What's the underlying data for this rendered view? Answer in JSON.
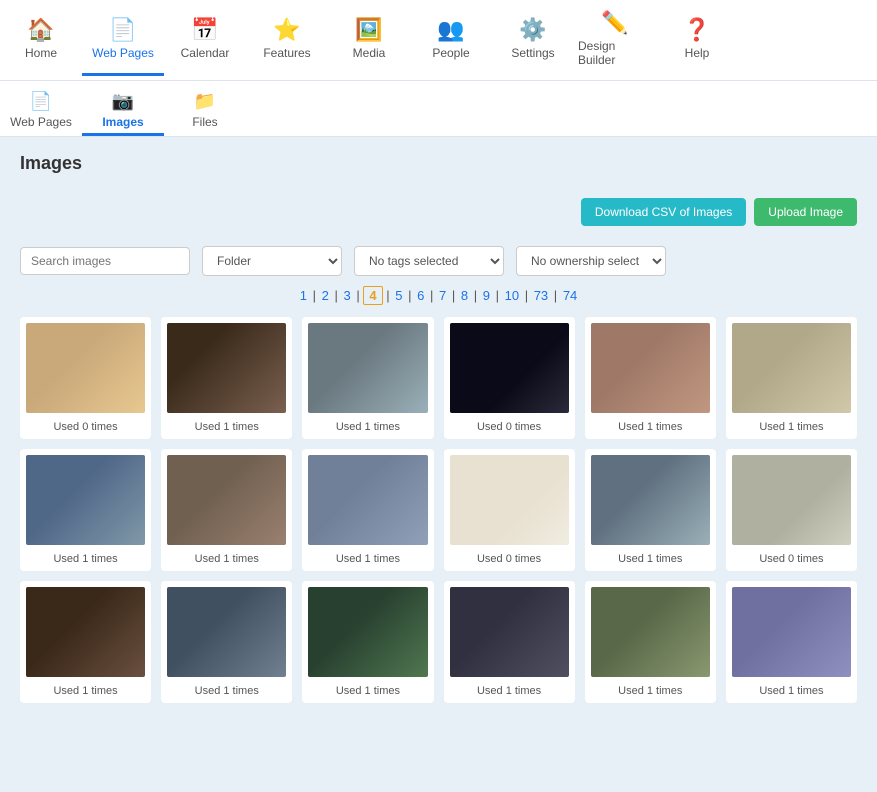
{
  "top_nav": {
    "items": [
      {
        "id": "home",
        "label": "Home",
        "icon": "🏠",
        "active": false
      },
      {
        "id": "web-pages",
        "label": "Web Pages",
        "icon": "📄",
        "active": false
      },
      {
        "id": "calendar",
        "label": "Calendar",
        "icon": "📅",
        "active": false
      },
      {
        "id": "features",
        "label": "Features",
        "icon": "⭐",
        "active": false
      },
      {
        "id": "media",
        "label": "Media",
        "icon": "🖼️",
        "active": false
      },
      {
        "id": "people",
        "label": "People",
        "icon": "👥",
        "active": false
      },
      {
        "id": "settings",
        "label": "Settings",
        "icon": "⚙️",
        "active": false
      },
      {
        "id": "design-builder",
        "label": "Design Builder",
        "icon": "✏️",
        "active": false
      },
      {
        "id": "help",
        "label": "Help",
        "icon": "❓",
        "active": false
      }
    ]
  },
  "sub_nav": {
    "items": [
      {
        "id": "web-pages",
        "label": "Web Pages",
        "icon": "📄",
        "active": false
      },
      {
        "id": "images",
        "label": "Images",
        "icon": "📷",
        "active": true
      },
      {
        "id": "files",
        "label": "Files",
        "icon": "📁",
        "active": false
      }
    ]
  },
  "page": {
    "title": "Images"
  },
  "toolbar": {
    "download_csv_label": "Download CSV of Images",
    "upload_label": "Upload Image"
  },
  "filters": {
    "search_placeholder": "Search images",
    "folder_placeholder": "Folder",
    "tags_placeholder": "No tags selected",
    "ownership_placeholder": "No ownership selected"
  },
  "pagination": {
    "pages": [
      "1",
      "2",
      "3",
      "4",
      "5",
      "6",
      "7",
      "8",
      "9",
      "10",
      "73",
      "74"
    ],
    "current": "4",
    "separator": "|"
  },
  "images": [
    {
      "id": 1,
      "used": "Used 0 times",
      "color": "#b08060"
    },
    {
      "id": 2,
      "used": "Used 1 times",
      "color": "#5a4a3a"
    },
    {
      "id": 3,
      "used": "Used 1 times",
      "color": "#6a7a8a"
    },
    {
      "id": 4,
      "used": "Used 0 times",
      "color": "#1a1a2a"
    },
    {
      "id": 5,
      "used": "Used 1 times",
      "color": "#8a7060"
    },
    {
      "id": 6,
      "used": "Used 1 times",
      "color": "#b0a080"
    },
    {
      "id": 7,
      "used": "Used 1 times",
      "color": "#5070a0"
    },
    {
      "id": 8,
      "used": "Used 1 times",
      "color": "#806050"
    },
    {
      "id": 9,
      "used": "Used 1 times",
      "color": "#7080a0"
    },
    {
      "id": 10,
      "used": "Used 0 times",
      "color": "#e8e8e8"
    },
    {
      "id": 11,
      "used": "Used 1 times",
      "color": "#708090"
    },
    {
      "id": 12,
      "used": "Used 0 times",
      "color": "#c0c0b0"
    },
    {
      "id": 13,
      "used": "Used 1 times",
      "color": "#4a3a2a"
    },
    {
      "id": 14,
      "used": "Used 1 times",
      "color": "#4a6070"
    },
    {
      "id": 15,
      "used": "Used 1 times",
      "color": "#2a4030"
    },
    {
      "id": 16,
      "used": "Used 1 times",
      "color": "#3a3a4a"
    },
    {
      "id": 17,
      "used": "Used 1 times",
      "color": "#6a8060"
    },
    {
      "id": 18,
      "used": "Used 1 times",
      "color": "#7070a0"
    }
  ],
  "image_colors": {
    "1": "#c9a87a",
    "2": "#4a3020",
    "3": "#7888a0",
    "4": "#18181f",
    "5": "#a08070",
    "6": "#c8b898",
    "7": "#607090",
    "8": "#907060",
    "9": "#8090b0",
    "10": "#e0e0d8",
    "11": "#708090",
    "12": "#c8c8b8",
    "13": "#503828",
    "14": "#506070",
    "15": "#304838",
    "16": "#404050",
    "17": "#789068",
    "18": "#8080b0"
  }
}
